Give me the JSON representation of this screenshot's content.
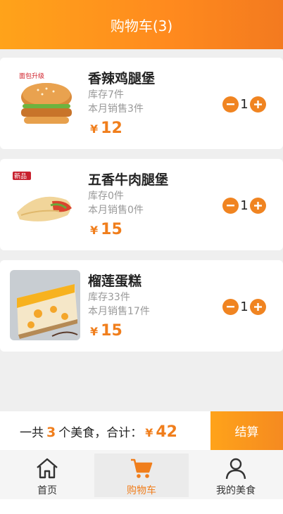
{
  "header": {
    "title": "购物车(3)"
  },
  "currency_symbol": "¥",
  "cart": {
    "items": [
      {
        "name": "香辣鸡腿堡",
        "stock": "库存7件",
        "monthly_sales": "本月销售3件",
        "price": "12",
        "quantity": "1",
        "badge": "面包升级"
      },
      {
        "name": "五香牛肉腿堡",
        "stock": "库存0件",
        "monthly_sales": "本月销售0件",
        "price": "15",
        "quantity": "1",
        "badge": "新品"
      },
      {
        "name": "榴莲蛋糕",
        "stock": "库存33件",
        "monthly_sales": "本月销售17件",
        "price": "15",
        "quantity": "1"
      }
    ]
  },
  "summary": {
    "prefix": "一共",
    "count": "3",
    "middle": "个美食，合计：",
    "total": "42",
    "checkout_label": "结算"
  },
  "tabbar": {
    "items": [
      {
        "label": "首页",
        "icon": "home-icon"
      },
      {
        "label": "购物车",
        "icon": "cart-icon"
      },
      {
        "label": "我的美食",
        "icon": "user-icon"
      }
    ]
  },
  "colors": {
    "accent": "#f07e1c",
    "header_start": "#ffa31a",
    "header_end": "#f37a1f"
  }
}
